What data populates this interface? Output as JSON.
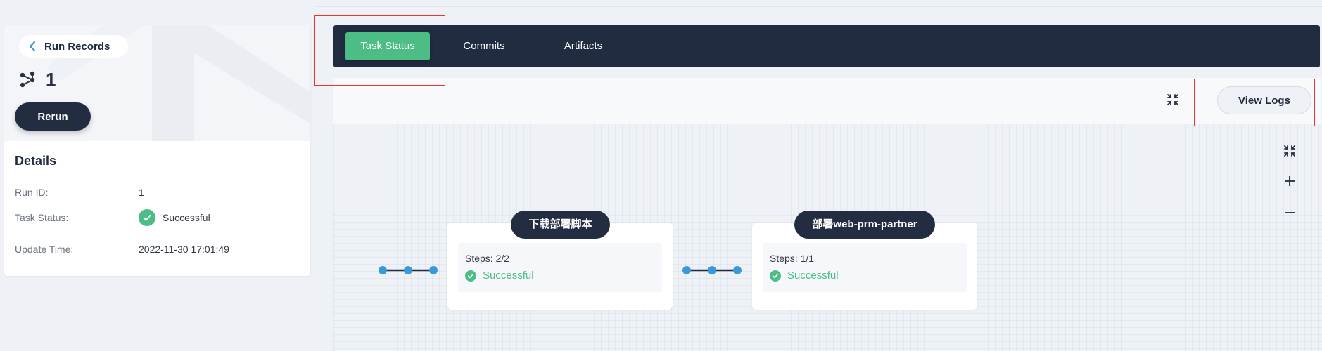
{
  "sidebar": {
    "back_label": "Run Records",
    "run_number": "1",
    "rerun_label": "Rerun",
    "details_title": "Details",
    "details": [
      {
        "key": "Run ID:",
        "value": "1"
      },
      {
        "key": "Task Status:",
        "value": "Successful",
        "icon": "check-circle-icon"
      },
      {
        "key": "Update Time:",
        "value": "2022-11-30 17:01:49"
      }
    ]
  },
  "tabs": [
    {
      "label": "Task Status",
      "active": true
    },
    {
      "label": "Commits",
      "active": false
    },
    {
      "label": "Artifacts",
      "active": false
    }
  ],
  "toolbar": {
    "view_logs_label": "View Logs",
    "fullscreen_icon": "fullscreen-icon"
  },
  "canvas_controls": {
    "icons": [
      "fit-view-icon",
      "zoom-in-icon",
      "zoom-out-icon"
    ]
  },
  "stages": [
    {
      "name": "下载部署脚本",
      "steps": "Steps: 2/2",
      "status": "Successful"
    },
    {
      "name": "部署web-prm-partner",
      "steps": "Steps: 1/1",
      "status": "Successful"
    }
  ],
  "colors": {
    "accent_green": "#4dbd86",
    "dark_navy": "#222c41",
    "connector_blue": "#3a9ad9",
    "annotation_red": "#ee3333"
  }
}
